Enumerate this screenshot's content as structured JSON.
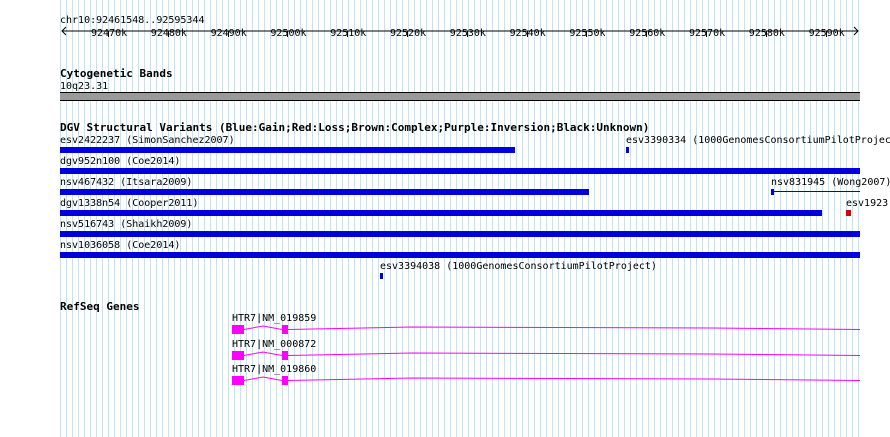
{
  "position": "chr10:92461548..92595344",
  "ruler_ticks": [
    "92470k",
    "92480k",
    "92490k",
    "92500k",
    "92510k",
    "92520k",
    "92530k",
    "92540k",
    "92550k",
    "92560k",
    "92570k",
    "92580k",
    "92590k"
  ],
  "tracks": {
    "cyto": {
      "title": "Cytogenetic Bands",
      "band": "10q23.31"
    },
    "dgv": {
      "title": "DGV Structural Variants (Blue:Gain;Red:Loss;Brown:Complex;Purple:Inversion;Black:Unknown)",
      "features": [
        "esv2422237 (SimonSanchez2007)",
        "esv3390334 (1000GenomesConsortiumPilotProject)",
        "dgv952n100 (Coe2014)",
        "nsv467432 (Itsara2009)",
        "nsv831945 (Wong2007)",
        "dgv1338n54 (Cooper2011)",
        "esv1923",
        "nsv516743 (Shaikh2009)",
        "nsv1036058 (Coe2014)",
        "esv3394038 (1000GenomesConsortiumPilotProject)"
      ]
    },
    "refseq": {
      "title": "RefSeq Genes",
      "genes": [
        "HTR7|NM_019859",
        "HTR7|NM_000872",
        "HTR7|NM_019860"
      ]
    }
  },
  "colors": {
    "gain": "#0000dd",
    "loss": "#dd0000",
    "gene": "#ff00ff",
    "grid": "#bfe4f2"
  }
}
